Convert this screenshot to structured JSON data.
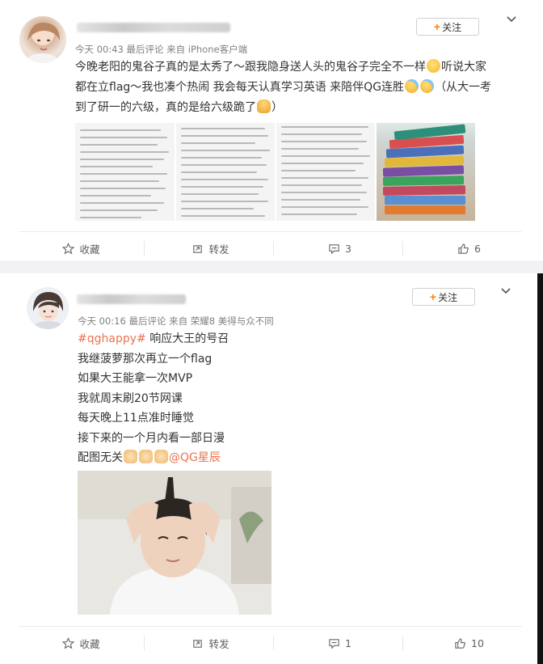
{
  "posts": [
    {
      "meta": {
        "time": "今天 00:43",
        "comment": "最后评论",
        "source": "来自 iPhone客户端"
      },
      "follow_label": "关注",
      "text": {
        "line1a": "今晚老阳的鬼谷子真的是太秀了～跟我隐身送人头的鬼谷子完全不一样",
        "line1b": "听说大家",
        "line2a": "都在立flag～我也凑个热闹 我会每天认真学习英语 来陪伴QG连胜",
        "line2b": "（从大一考",
        "line3a": "到了研一的六级，真的是给六级跪了",
        "line3b": "）"
      },
      "actions": {
        "favorite": "收藏",
        "repost": "转发",
        "comment": "3",
        "like": "6"
      },
      "icons": [
        "star-icon",
        "repost-icon",
        "comment-icon",
        "like-icon"
      ]
    },
    {
      "meta": {
        "time": "今天 00:16",
        "comment": "最后评论",
        "source": "来自 荣耀8 美得与众不同"
      },
      "follow_label": "关注",
      "text": {
        "tag": "#qghappy#",
        "line1_rest": " 响应大王的号召",
        "line2": "我继菠萝那次再立一个flag",
        "line3": "如果大王能拿一次MVP",
        "line4": "我就周末刷20节网课",
        "line5": "每天晚上11点准时睡觉",
        "line6": "接下来的一个月内看一部日漫",
        "line7": "配图无关",
        "mention": "@QG星辰"
      },
      "actions": {
        "favorite": "收藏",
        "repost": "转发",
        "comment": "1",
        "like": "10"
      }
    }
  ],
  "colors": {
    "accent": "#ff8200",
    "link": "#eb7350",
    "meta": "#808080",
    "divider_bg": "#f2f2f5"
  }
}
